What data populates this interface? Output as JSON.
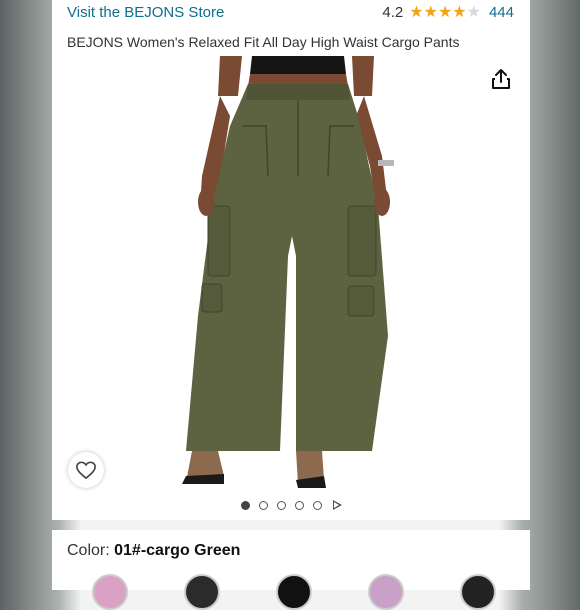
{
  "store": {
    "link_text": "Visit the BEJONS Store"
  },
  "rating": {
    "value": "4.2",
    "stars": 4.2,
    "count": "444",
    "star_color": "#f0a41b"
  },
  "product": {
    "title": "BEJONS Women's Relaxed Fit All Day High Waist Cargo Pants"
  },
  "gallery": {
    "image_count": 5,
    "active_index": 0,
    "has_video": true
  },
  "icons": {
    "share": "share-icon",
    "wishlist": "heart-icon",
    "video": "play-icon"
  },
  "variation": {
    "label": "Color: ",
    "value": "01#-cargo Green",
    "swatch_colors": [
      "#d9a2c4",
      "#2b2b2b",
      "#111111",
      "#c9a0c8",
      "#222222"
    ]
  },
  "colors": {
    "link": "#0f6e8c",
    "pants": "#5d6340",
    "skin": "#7a4a32"
  }
}
